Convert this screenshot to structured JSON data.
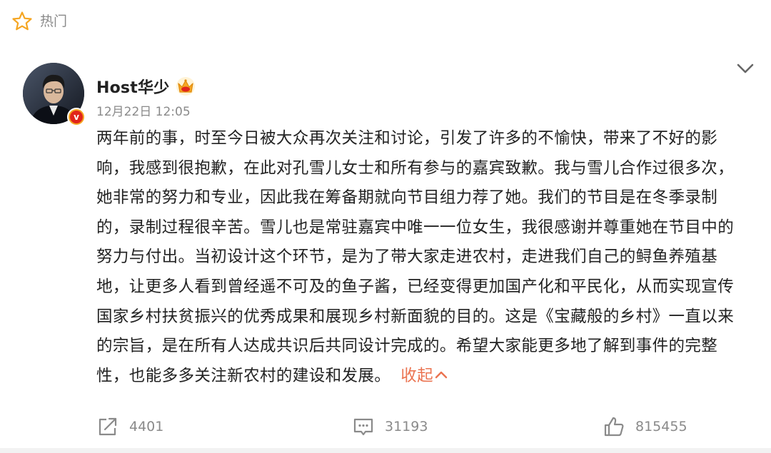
{
  "hot_tag": {
    "label": "热门",
    "icon": "star-outline-icon"
  },
  "post": {
    "author": {
      "name": "Host华少",
      "badge_icon": "crown-icon",
      "verified_icon": "verified-v-icon",
      "verified_letter": "v"
    },
    "timestamp": "12月22日 12:05",
    "more_icon": "chevron-down-icon",
    "body": "两年前的事，时至今日被大众再次关注和讨论，引发了许多的不愉快，带来了不好的影响，我感到很抱歉，在此对孔雪儿女士和所有参与的嘉宾致歉。我与雪儿合作过很多次，她非常的努力和专业，因此我在筹备期就向节目组力荐了她。我们的节目是在冬季录制的，录制过程很辛苦。雪儿也是常驻嘉宾中唯一一位女生，我很感谢并尊重她在节目中的努力与付出。当初设计这个环节，是为了带大家走进农村，走进我们自己的鲟鱼养殖基地，让更多人看到曾经遥不可及的鱼子酱，已经变得更加国产化和平民化，从而实现宣传国家乡村扶贫振兴的优秀成果和展现乡村新面貌的目的。这是《宝藏般的乡村》一直以来的宗旨，是在所有人达成共识后共同设计完成的。希望大家能更多地了解到事件的完整性，也能多多关注新农村的建设和发展。",
    "collapse_label": "收起",
    "collapse_icon": "chevron-up-icon",
    "actions": {
      "share": {
        "icon": "share-icon",
        "count": "4401"
      },
      "comment": {
        "icon": "comment-icon",
        "count": "31193"
      },
      "like": {
        "icon": "thumbs-up-icon",
        "count": "815455"
      }
    }
  },
  "colors": {
    "accent_orange": "#eb7350",
    "text_primary": "#222222",
    "text_secondary": "#8a8a8a",
    "crown_gold": "#f5a623",
    "verified_red": "#e1251b"
  }
}
